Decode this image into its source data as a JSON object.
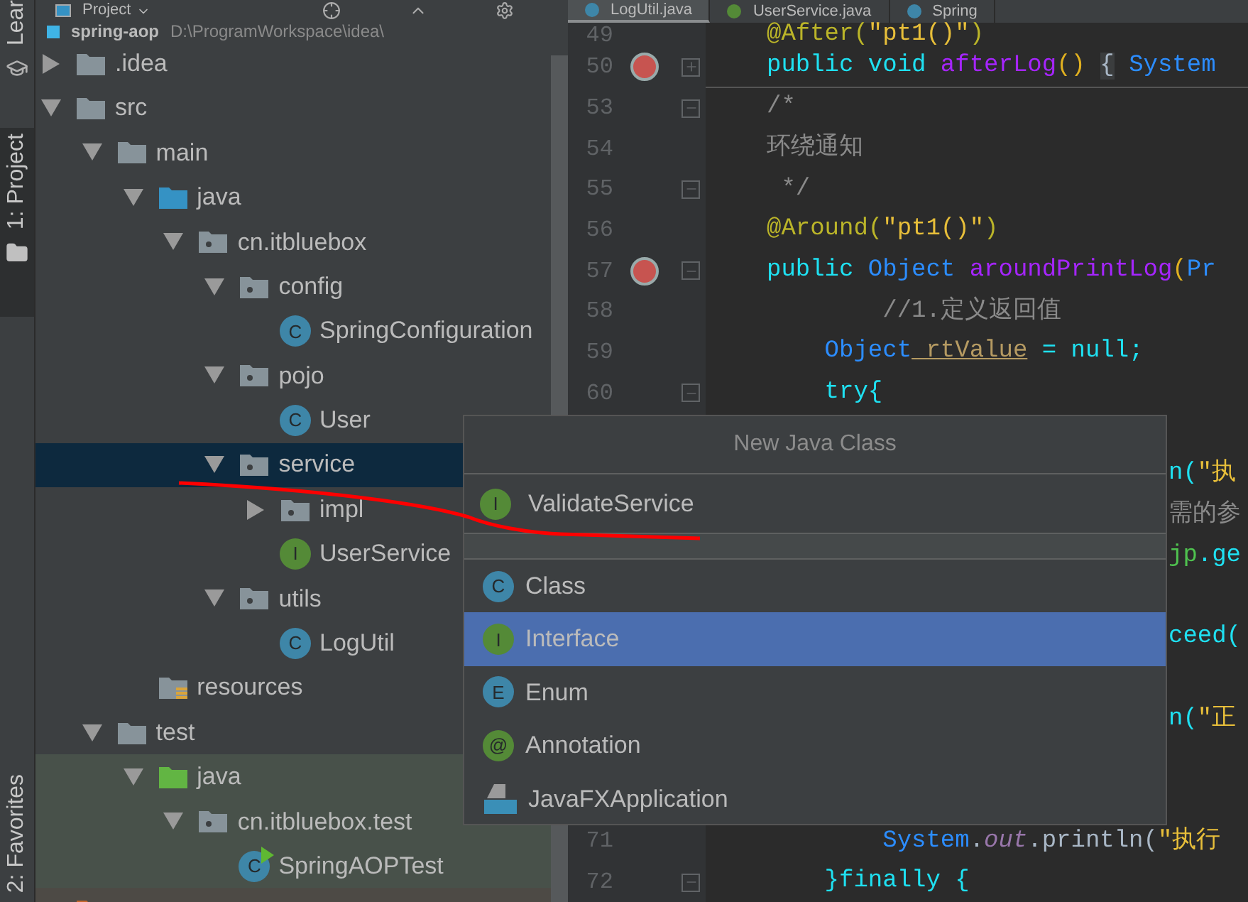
{
  "side_strip": {
    "tabs": [
      {
        "label": "Lear",
        "selected": false
      },
      {
        "label": "1: Project",
        "selected": true
      }
    ],
    "bottom_tab": "2: Favorites"
  },
  "project_panel": {
    "title": "Project",
    "root": {
      "name": "spring-aop",
      "location": "D:\\ProgramWorkspace\\idea\\"
    },
    "items": [
      {
        "name": ".idea",
        "kind": "folder",
        "expanded": false,
        "selected": false
      },
      {
        "name": "src",
        "kind": "folder",
        "expanded": true,
        "selected": false,
        "children": [
          {
            "name": "main",
            "kind": "folder",
            "expanded": true,
            "selected": false,
            "children": [
              {
                "name": "java",
                "kind": "source-root",
                "expanded": true,
                "selected": false,
                "children": [
                  {
                    "name": "cn.itbluebox",
                    "kind": "package",
                    "expanded": true,
                    "selected": false,
                    "children": [
                      {
                        "name": "config",
                        "kind": "package",
                        "expanded": true,
                        "selected": false,
                        "children": [
                          {
                            "name": "SpringConfiguration",
                            "kind": "class",
                            "badge": "C",
                            "selected": false
                          }
                        ]
                      },
                      {
                        "name": "pojo",
                        "kind": "package",
                        "expanded": true,
                        "selected": false,
                        "children": [
                          {
                            "name": "User",
                            "kind": "class",
                            "badge": "C",
                            "selected": false
                          }
                        ]
                      },
                      {
                        "name": "service",
                        "kind": "package",
                        "expanded": true,
                        "selected": true,
                        "children": [
                          {
                            "name": "impl",
                            "kind": "package",
                            "expanded": false,
                            "selected": false
                          },
                          {
                            "name": "UserService",
                            "kind": "interface",
                            "badge": "I",
                            "selected": false
                          }
                        ]
                      },
                      {
                        "name": "utils",
                        "kind": "package",
                        "expanded": true,
                        "selected": false,
                        "children": [
                          {
                            "name": "LogUtil",
                            "kind": "class",
                            "badge": "C",
                            "selected": false
                          }
                        ]
                      }
                    ]
                  }
                ]
              },
              {
                "name": "resources",
                "kind": "resources",
                "selected": false
              }
            ]
          },
          {
            "name": "test",
            "kind": "folder",
            "expanded": true,
            "selected": false,
            "children": [
              {
                "name": "java",
                "kind": "test-root",
                "expanded": true,
                "selected": false,
                "children": [
                  {
                    "name": "cn.itbluebox.test",
                    "kind": "package",
                    "expanded": true,
                    "selected": false,
                    "children": [
                      {
                        "name": "SpringAOPTest",
                        "kind": "test-class",
                        "badge": "C",
                        "selected": false
                      }
                    ]
                  }
                ]
              }
            ]
          }
        ]
      },
      {
        "kind": "excluded-folder",
        "selected": false
      }
    ]
  },
  "editor": {
    "tabs": [
      {
        "label": "LogUtil.java",
        "kind": "class",
        "selected": true
      },
      {
        "label": "UserService.java",
        "kind": "interface",
        "selected": false
      },
      {
        "label": "Spring",
        "kind": "class",
        "selected": false
      }
    ],
    "lines": [
      {
        "kind": "code",
        "number": "49",
        "tokens": [
          {
            "t": "@After(",
            "kind": "annotation"
          },
          {
            "t": "\"pt1()\"",
            "kind": "string"
          },
          {
            "t": ")",
            "kind": "annotation"
          }
        ]
      },
      {
        "kind": "code",
        "number": "50",
        "marker": true,
        "fold": {
          "kind": "expand"
        },
        "separator": true,
        "tokens": [
          {
            "t": "public",
            "kind": "keyword"
          },
          {
            "t": " void",
            "kind": "keyword"
          },
          {
            "t": " afterLog",
            "kind": "method"
          },
          {
            "t": "() ",
            "kind": "paren"
          },
          {
            "t": "{",
            "kind": "fold"
          },
          {
            "t": " System",
            "kind": "type"
          }
        ]
      },
      {
        "kind": "code",
        "number": "53",
        "fold": {
          "kind": "collapse"
        },
        "tokens": [
          {
            "t": "/*",
            "kind": "comment"
          }
        ]
      },
      {
        "kind": "code",
        "number": "54",
        "tokens": [
          {
            "t": "环绕通知",
            "kind": "comment"
          }
        ]
      },
      {
        "kind": "code",
        "number": "55",
        "fold": {
          "kind": "collapse"
        },
        "tokens": [
          {
            "t": " */",
            "kind": "comment"
          }
        ]
      },
      {
        "kind": "code",
        "number": "56",
        "tokens": [
          {
            "t": "@Around(",
            "kind": "annotation"
          },
          {
            "t": "\"pt1()\"",
            "kind": "string"
          },
          {
            "t": ")",
            "kind": "annotation"
          }
        ]
      },
      {
        "kind": "code",
        "number": "57",
        "marker": true,
        "fold": {
          "kind": "collapse"
        },
        "tokens": [
          {
            "t": "public",
            "kind": "keyword"
          },
          {
            "t": " Object",
            "kind": "type"
          },
          {
            "t": " aroundPrintLog",
            "kind": "method"
          },
          {
            "t": "(",
            "kind": "paren"
          },
          {
            "t": "Pr",
            "kind": "type"
          }
        ]
      },
      {
        "kind": "code",
        "number": "58",
        "tokens": [
          {
            "t": "        //1.定义返回值",
            "kind": "comment"
          }
        ]
      },
      {
        "kind": "code",
        "number": "59",
        "tokens": [
          {
            "t": "    Object",
            "kind": "type"
          },
          {
            "t": " rtValue",
            "kind": "field"
          },
          {
            "t": " = null;",
            "kind": "keyword"
          }
        ]
      },
      {
        "kind": "code",
        "number": "60",
        "fold": {
          "kind": "collapse"
        },
        "tokens": [
          {
            "t": "    try{",
            "kind": "keyword"
          }
        ]
      },
      {
        "kind": "covered"
      },
      {
        "kind": "covered",
        "tokens": [
          {
            "t": "n(",
            "kind": "keyword"
          },
          {
            "t": "\"执",
            "kind": "string"
          }
        ]
      },
      {
        "kind": "covered",
        "tokens": [
          {
            "t": "需的参",
            "kind": "comment"
          }
        ]
      },
      {
        "kind": "covered",
        "tokens": [
          {
            "t": "jp",
            "kind": "local"
          },
          {
            "t": ".ge",
            "kind": "keyword"
          }
        ]
      },
      {
        "kind": "covered"
      },
      {
        "kind": "covered",
        "tokens": [
          {
            "t": "ceed(",
            "kind": "keyword"
          }
        ]
      },
      {
        "kind": "covered"
      },
      {
        "kind": "covered",
        "tokens": [
          {
            "t": "n(",
            "kind": "keyword"
          },
          {
            "t": "\"正",
            "kind": "string"
          }
        ]
      },
      {
        "kind": "covered"
      },
      {
        "kind": "covered"
      },
      {
        "kind": "code",
        "number": "71",
        "tokens": [
          {
            "t": "        System",
            "kind": "type"
          },
          {
            "t": ".",
            "kind": "plain"
          },
          {
            "t": "out",
            "kind": "static"
          },
          {
            "t": ".println(",
            "kind": "plain"
          },
          {
            "t": "\"执行",
            "kind": "string"
          }
        ]
      },
      {
        "kind": "code",
        "number": "72",
        "fold": {
          "kind": "collapse"
        },
        "tokens": [
          {
            "t": "    }finally {",
            "kind": "keyword"
          }
        ]
      }
    ]
  },
  "popup": {
    "title": "New Java Class",
    "name_field": {
      "value": "ValidateService",
      "badge": "I"
    },
    "items": [
      {
        "label": "Class",
        "kind": "class",
        "badge": "C",
        "selected": false
      },
      {
        "label": "Interface",
        "kind": "interface",
        "badge": "I",
        "selected": true
      },
      {
        "label": "Enum",
        "kind": "enum",
        "badge": "E",
        "selected": false
      },
      {
        "label": "Annotation",
        "kind": "annotation",
        "badge": "@",
        "selected": false
      },
      {
        "label": "JavaFXApplication",
        "kind": "javafx",
        "selected": false
      }
    ]
  }
}
